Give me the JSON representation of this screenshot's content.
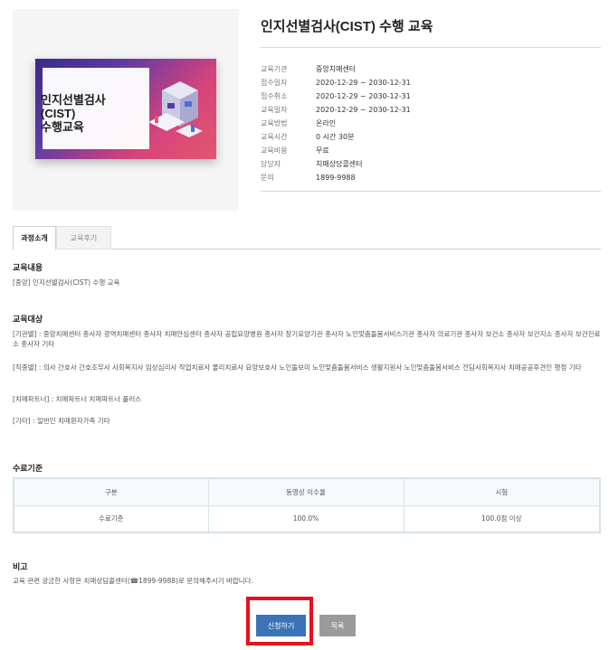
{
  "course": {
    "title": "인지선별검사(CIST) 수행 교육",
    "thumbnail_line1": "인지선별검사(CIST)",
    "thumbnail_line2": "수행교육",
    "info": [
      {
        "label": "교육기관",
        "value": "중앙치매센터"
      },
      {
        "label": "접수일자",
        "value": "2020-12-29 ~ 2030-12-31"
      },
      {
        "label": "접수취소",
        "value": "2020-12-29 ~ 2030-12-31"
      },
      {
        "label": "교육일자",
        "value": "2020-12-29 ~ 2030-12-31"
      },
      {
        "label": "교육방법",
        "value": "온라인"
      },
      {
        "label": "교육시간",
        "value": "0 시간 30분"
      },
      {
        "label": "교육비용",
        "value": "무료"
      },
      {
        "label": "담당자",
        "value": "치매상담콜센터"
      },
      {
        "label": "문의",
        "value": "1899-9988"
      }
    ]
  },
  "tabs": [
    {
      "label": "과정소개",
      "active": true
    },
    {
      "label": "교육후기",
      "active": false
    }
  ],
  "content": {
    "heading": "교육내용",
    "text": "[중앙] 인지선별검사(CIST) 수행 교육"
  },
  "target": {
    "heading": "교육대상",
    "items": [
      "[기관별] : 중앙치매센터 종사자 광역치매센터 종사자 치매안심센터 종사자 공립요양병원 종사자 장기요양기관 종사자 노인맞춤돌봄서비스기관 종사자 의료기관 종사자 보건소 종사자 보건지소 종사자 보건진료소 종사자 기타",
      "[직종별] : 의사 간호사 간호조무사 사회복지사 임상심리사 작업치료사 물리치료사 요양보호사 노인돌보미 노인맞춤돌봄서비스 생활지원사 노인맞춤돌봄서비스 전담사회복지사 치매공공후견인 행정 기타",
      "[치매파트너] : 치매파트너 치매파트너 플러스",
      "[기타] : 일반인 치매환자가족 기타"
    ]
  },
  "completion": {
    "heading": "수료기준",
    "headers": [
      "구분",
      "동영상 이수율",
      "시험"
    ],
    "row": [
      "수료기준",
      "100.0%",
      "100.0점 이상"
    ]
  },
  "note": {
    "heading": "비고",
    "text": "교육 관련 궁금한 사항은 치매상담콜센터(☎1899-9988)로 문의해주시기 바랍니다."
  },
  "buttons": {
    "apply": "신청하기",
    "list": "목록"
  },
  "colors": {
    "apply_button": "#3a74b7",
    "list_button": "#9a9a9a",
    "highlight_border": "#e8101e"
  }
}
